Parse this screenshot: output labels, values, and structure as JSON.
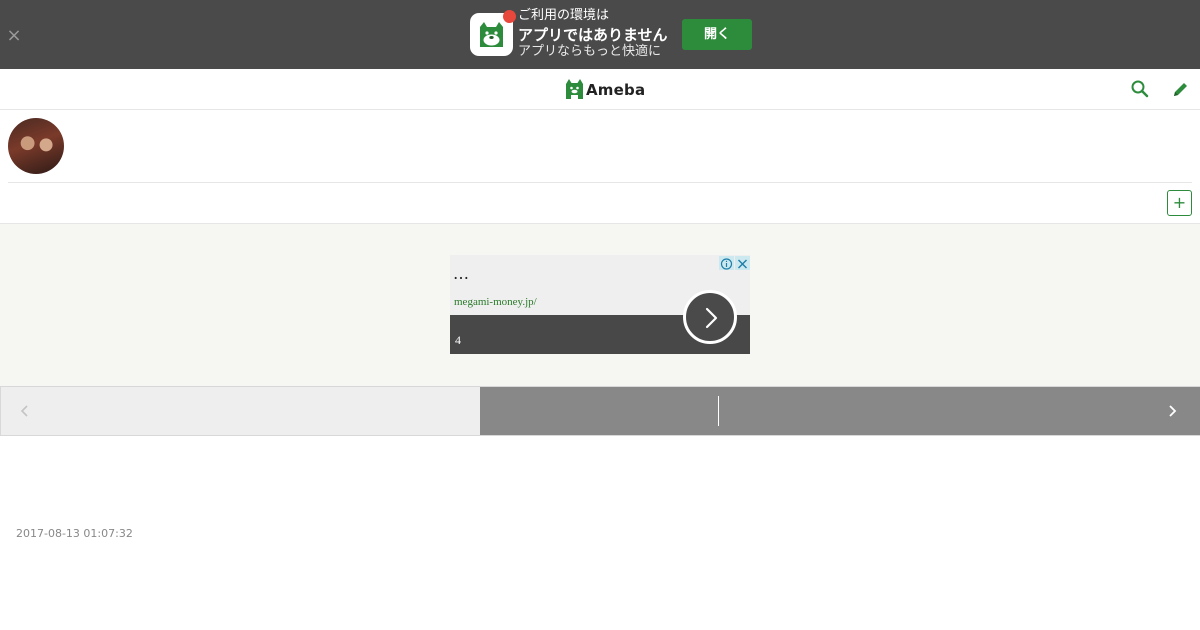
{
  "app_banner": {
    "close_label": "×",
    "line1": "ご利用の環境は",
    "line2": "アプリではありません",
    "line3": "アプリならもっと快適に",
    "open_button_label": "開く",
    "accent_color": "#2d8c3c",
    "notify_color": "#e8473c"
  },
  "header": {
    "logo_text": "Ameba",
    "search_icon": "search-icon",
    "edit_icon": "pencil-icon"
  },
  "profile": {
    "follow_label": "+"
  },
  "ad": {
    "title": "…",
    "url": "megami-money.jp/",
    "number": "4"
  },
  "post": {
    "date": "2017-08-13 01:07:32"
  }
}
